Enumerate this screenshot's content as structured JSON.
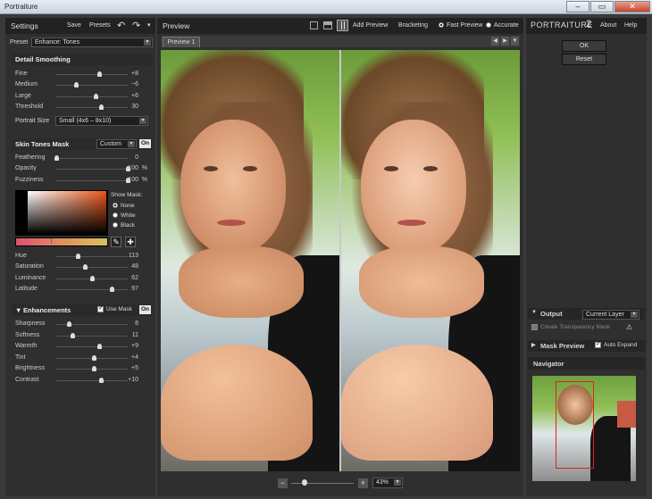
{
  "window": {
    "title": "Portraiture",
    "min": "–",
    "max": "▭",
    "close": "✕"
  },
  "settings": {
    "title": "Settings",
    "save": "Save",
    "presets": "Presets",
    "undo": "↶",
    "redo": "↷",
    "preset_label": "Preset",
    "preset_value": "Enhance: Tones",
    "detail": {
      "title": "Detail Smoothing",
      "rows": [
        {
          "label": "Fine",
          "value": "+8",
          "pos": 0.6
        },
        {
          "label": "Medium",
          "value": "−6",
          "pos": 0.28
        },
        {
          "label": "Large",
          "value": "+6",
          "pos": 0.55
        },
        {
          "label": "Threshold",
          "value": "30",
          "pos": 0.62
        }
      ],
      "size_label": "Portrait Size",
      "size_value": "Small (4x6 – 8x10)"
    },
    "skin": {
      "title": "Skin Tones Mask",
      "mode": "Custom",
      "on": "On",
      "rows": [
        {
          "label": "Feathering",
          "value": "0",
          "unit": "",
          "pos": 0.0
        },
        {
          "label": "Opacity",
          "value": "100",
          "unit": "%",
          "pos": 1.0
        },
        {
          "label": "Fuzziness",
          "value": "100",
          "unit": "%",
          "pos": 1.0
        }
      ],
      "show_mask": "Show Mask:",
      "options": [
        "None",
        "White",
        "Black"
      ],
      "hsl": [
        {
          "label": "Hue",
          "value": "113",
          "pos": 0.3
        },
        {
          "label": "Saturation",
          "value": "48",
          "pos": 0.4
        },
        {
          "label": "Luminance",
          "value": "62",
          "pos": 0.5
        },
        {
          "label": "Latitude",
          "value": "97",
          "pos": 0.78
        }
      ]
    },
    "enh": {
      "title": "Enhancements",
      "use_mask": "Use Mask",
      "on": "On",
      "rows": [
        {
          "label": "Sharpness",
          "value": "8",
          "pos": 0.18
        },
        {
          "label": "Softness",
          "value": "11",
          "pos": 0.22
        },
        {
          "label": "Warmth",
          "value": "+9",
          "pos": 0.6
        },
        {
          "label": "Tint",
          "value": "+4",
          "pos": 0.53
        },
        {
          "label": "Brightness",
          "value": "+5",
          "pos": 0.53
        },
        {
          "label": "Contrast",
          "value": "+10",
          "pos": 0.62
        }
      ]
    }
  },
  "preview": {
    "title": "Preview",
    "add": "Add Preview",
    "bracketing": "Bracketing",
    "fast": "Fast Preview",
    "accurate": "Accurate",
    "tab": "Preview 1",
    "zoom": "43%",
    "minus": "−",
    "plus": "+"
  },
  "right": {
    "brand": "PORTRAITURE",
    "ver": "2",
    "about": "About",
    "help": "Help",
    "ok": "OK",
    "reset": "Reset",
    "output": "Output",
    "output_value": "Current Layer",
    "transparency": "Create Transparency Mask",
    "mask_preview": "Mask Preview",
    "auto_expand": "Auto Expand",
    "navigator": "Navigator"
  }
}
